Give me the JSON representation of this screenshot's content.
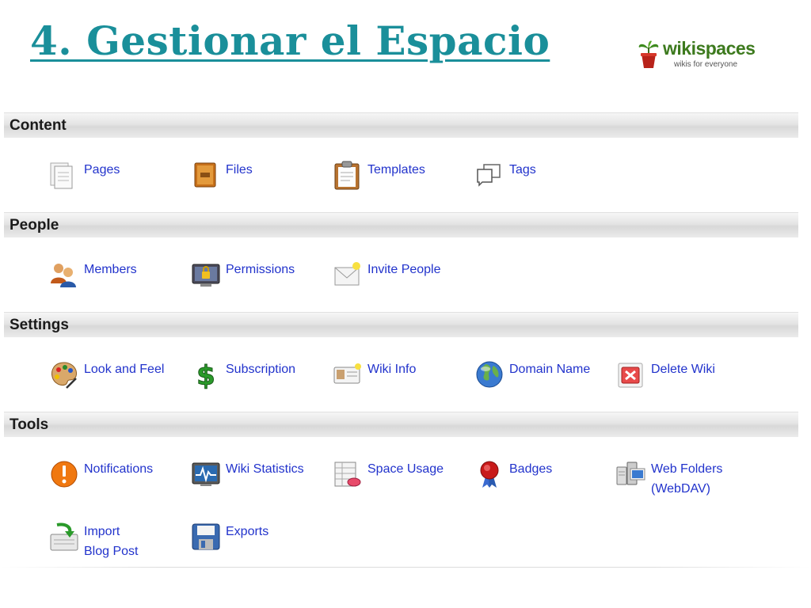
{
  "slide": {
    "title": "4. Gestionar el Espacio"
  },
  "logo": {
    "name": "wikispaces",
    "tagline": "wikis for everyone"
  },
  "colors": {
    "title": "#1a8f9a",
    "link": "#2233cc",
    "section_header_bg": "#e4e4e4"
  },
  "sections": {
    "content": {
      "label": "Content",
      "items": [
        {
          "label": "Pages",
          "icon": "pages-icon"
        },
        {
          "label": "Files",
          "icon": "files-icon"
        },
        {
          "label": "Templates",
          "icon": "templates-icon"
        },
        {
          "label": "Tags",
          "icon": "tags-icon"
        }
      ]
    },
    "people": {
      "label": "People",
      "items": [
        {
          "label": "Members",
          "icon": "members-icon"
        },
        {
          "label": "Permissions",
          "icon": "permissions-icon"
        },
        {
          "label": "Invite People",
          "icon": "invite-people-icon"
        }
      ]
    },
    "settings": {
      "label": "Settings",
      "items": [
        {
          "label": "Look and Feel",
          "icon": "palette-icon"
        },
        {
          "label": "Subscription",
          "icon": "dollar-icon"
        },
        {
          "label": "Wiki Info",
          "icon": "id-card-icon"
        },
        {
          "label": "Domain Name",
          "icon": "globe-icon"
        },
        {
          "label": "Delete Wiki",
          "icon": "delete-icon"
        }
      ]
    },
    "tools": {
      "label": "Tools",
      "items": [
        {
          "label": "Notifications",
          "icon": "notification-icon"
        },
        {
          "label": "Wiki Statistics",
          "icon": "statistics-icon"
        },
        {
          "label": "Space Usage",
          "icon": "space-usage-icon"
        },
        {
          "label": "Badges",
          "icon": "badge-icon"
        },
        {
          "label_line1": "Web Folders",
          "label_line2": "(WebDAV)",
          "icon": "web-folders-icon"
        },
        {
          "label_line1": "Import",
          "label_line2": "Blog Post",
          "icon": "import-icon"
        },
        {
          "label": "Exports",
          "icon": "exports-icon"
        }
      ]
    }
  }
}
